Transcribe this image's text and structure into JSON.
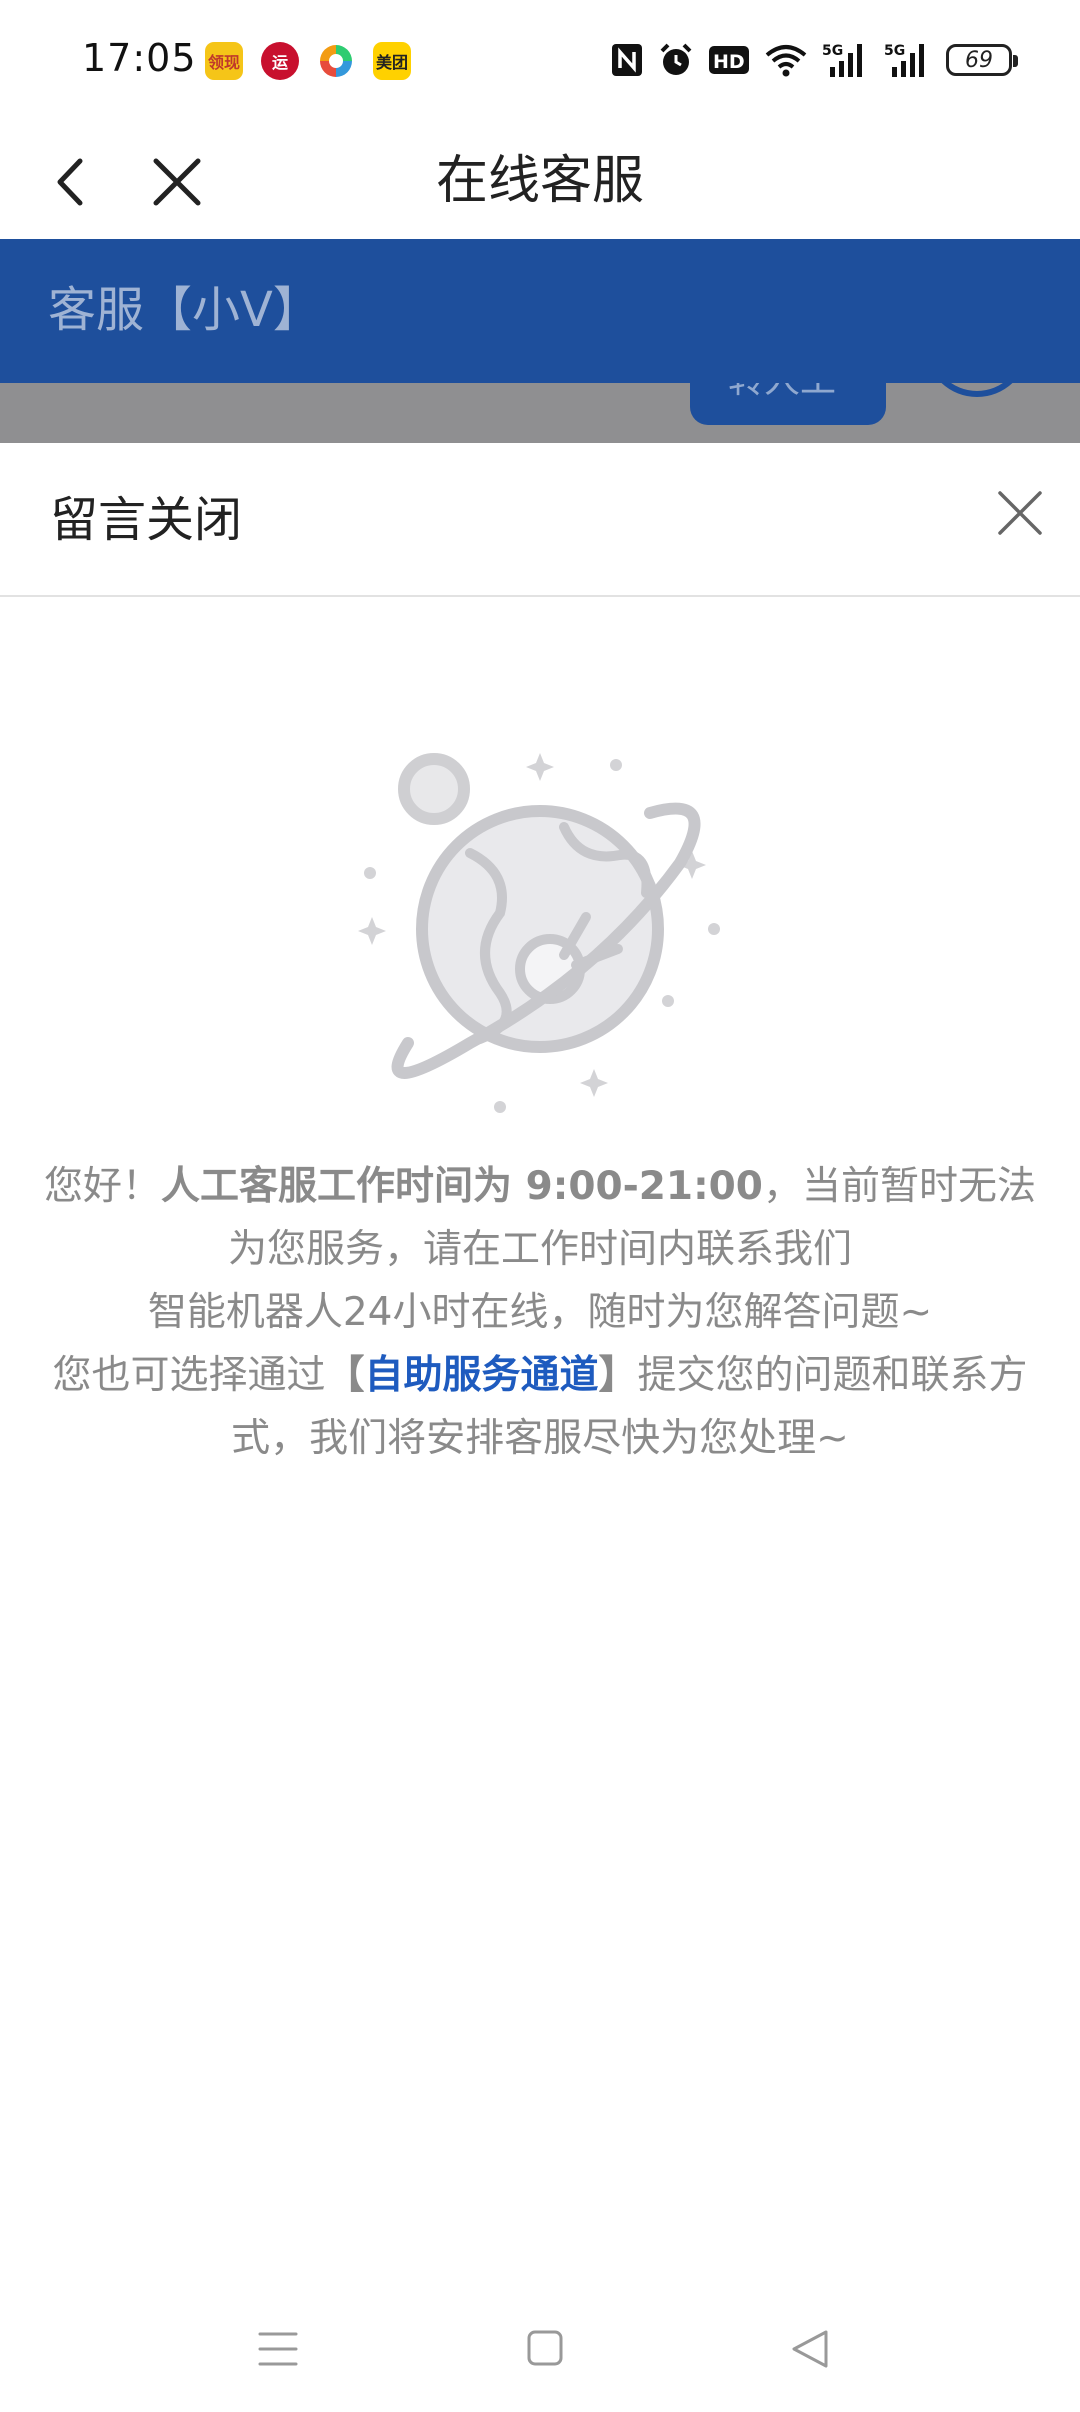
{
  "status_bar": {
    "time": "17:05",
    "notification_icons": [
      {
        "name": "app-icon-1",
        "text": "领现",
        "bg": "#f5c518",
        "fg": "#c0392b"
      },
      {
        "name": "app-icon-2",
        "text": "运",
        "bg": "#c8102e",
        "fg": "#ffffff"
      },
      {
        "name": "app-icon-3",
        "text": "",
        "bg": "#ffffff",
        "fg": "#000000"
      },
      {
        "name": "app-icon-4",
        "text": "美团",
        "bg": "#ffd100",
        "fg": "#222222"
      }
    ],
    "battery_level": "69"
  },
  "nav": {
    "title": "在线客服"
  },
  "banner": {
    "agent_name": "客服【小V】"
  },
  "chat_background": {
    "button_label": "转人工"
  },
  "sheet": {
    "title": "留言关闭",
    "message": {
      "greeting": "您好！",
      "hours_bold": "人工客服工作时间为 9:00-21:00",
      "after_hours": "，当前暂时无法为您服务，请在工作时间内联系我们",
      "bot_line": "智能机器人24小时在线，随时为您解答问题~",
      "self_service_prefix": "您也可选择通过",
      "bracket_open": "【",
      "self_service_link": "自助服务通道",
      "bracket_close": "】",
      "self_service_suffix": "提交您的问题和联系方式，我们将安排客服尽快为您处理~"
    }
  },
  "colors": {
    "brand_blue": "#1e4f9c",
    "link_blue": "#1e5bbf",
    "muted_text": "#8a8a8a"
  }
}
